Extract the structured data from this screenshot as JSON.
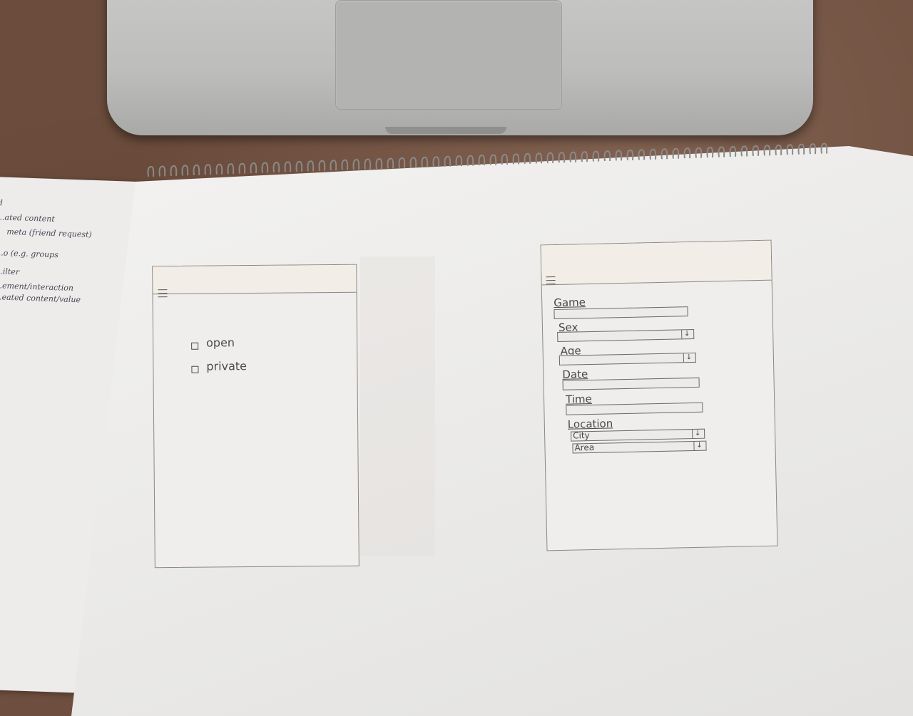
{
  "notes": {
    "lines": [
      "d",
      "...ated content",
      "meta (friend request)",
      "...o (e.g. groups",
      "...ilter",
      "...ement/interaction",
      "...eated content/value"
    ]
  },
  "wireframe_left": {
    "menu_icon": "hamburger-icon",
    "options": [
      "open",
      "private"
    ]
  },
  "wireframe_right": {
    "menu_icon": "hamburger-icon",
    "fields": {
      "game": "Game",
      "sex": "Sex",
      "age": "Age",
      "date": "Date",
      "time": "Time",
      "location": "Location",
      "city": "City",
      "area": "Area"
    },
    "dropdown_arrow": "↓"
  },
  "colors": {
    "table": "#6c4d3d",
    "paper": "#f1f0ee",
    "laptop": "#c2c2c0",
    "pencil": "#4e4a48"
  }
}
